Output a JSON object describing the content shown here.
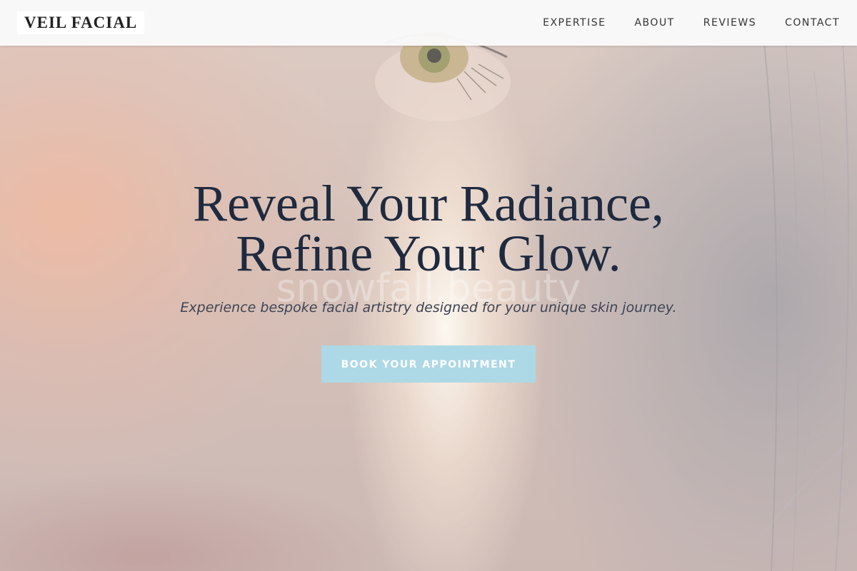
{
  "header": {
    "logo": "VEIL FACIAL",
    "nav": [
      {
        "label": "EXPERTISE"
      },
      {
        "label": "ABOUT"
      },
      {
        "label": "REVIEWS"
      },
      {
        "label": "CONTACT"
      }
    ]
  },
  "hero": {
    "headline_line1": "Reveal Your Radiance,",
    "headline_line2": "Refine Your Glow.",
    "watermark": "snowfall.beauty",
    "subtitle": "Experience bespoke facial artistry designed for your unique skin journey.",
    "cta_label": "BOOK YOUR APPOINTMENT"
  },
  "colors": {
    "headline": "#1f2a3f",
    "cta_background": "#add8e6",
    "header_background": "#fafafa"
  }
}
